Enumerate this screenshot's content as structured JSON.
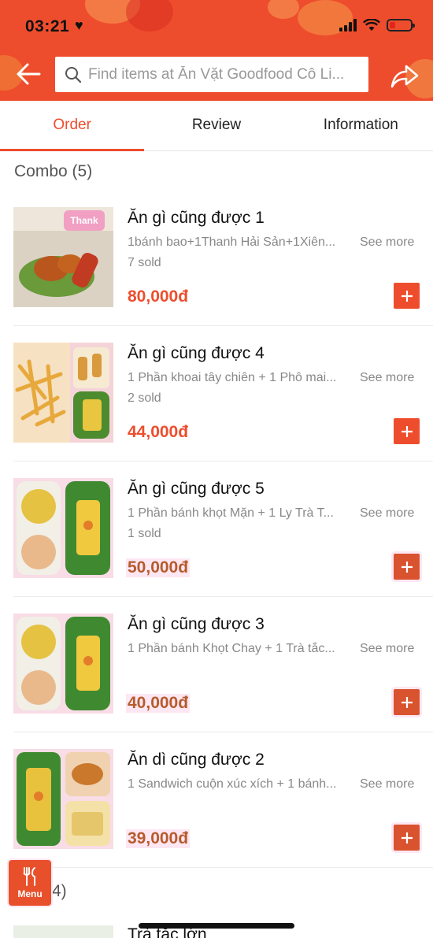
{
  "status_bar": {
    "time": "03:21",
    "heart": "♥"
  },
  "header": {
    "search_placeholder": "Find items at Ăn Vặt Goodfood Cô Li...",
    "back_icon": "arrow-left-icon",
    "share_icon": "share-icon",
    "accent_color": "#ee4d2d"
  },
  "tabs": [
    {
      "label": "Order",
      "active": true
    },
    {
      "label": "Review",
      "active": false
    },
    {
      "label": "Information",
      "active": false
    }
  ],
  "sections": [
    {
      "title": "Combo (5)",
      "items": [
        {
          "name": " Ăn gì cũng được 1",
          "desc": "1bánh bao+1Thanh Hải Sản+1Xiên...",
          "see_more": "See more",
          "sold": "7 sold",
          "price": "80,000đ"
        },
        {
          "name": "Ăn gì cũng được 4",
          "desc": "1 Phần khoai tây chiên + 1 Phô mai...",
          "see_more": "See more",
          "sold": "2 sold",
          "price": "44,000đ"
        },
        {
          "name": "Ăn gì cũng được 5",
          "desc": "1 Phần bánh khọt Mặn + 1 Ly Trà T...",
          "see_more": "See more",
          "sold": "1 sold",
          "price": "50,000đ"
        },
        {
          "name": "Ăn gì cũng được 3",
          "desc": "1 Phần bánh Khọt Chay + 1 Trà tắc...",
          "see_more": "See more",
          "sold": "",
          "price": "40,000đ"
        },
        {
          "name": "Ăn dì cũng được 2",
          "desc": "1 Sandwich cuộn xúc xích + 1 bánh...",
          "see_more": "See more",
          "sold": "",
          "price": "39,000đ"
        }
      ]
    }
  ],
  "section2": {
    "count_visible": "4)"
  },
  "next_item": {
    "name": "Trà tắc lớn"
  },
  "menu_fab": {
    "label": "Menu"
  }
}
